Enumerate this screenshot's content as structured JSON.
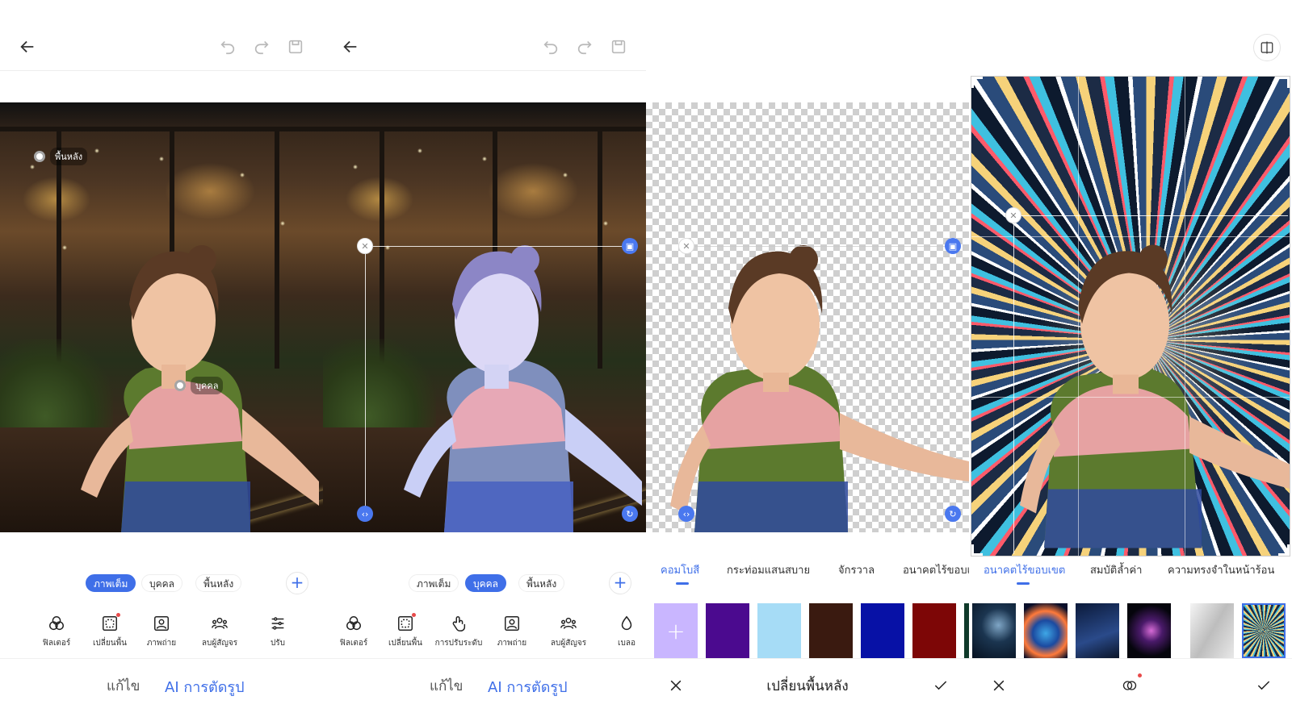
{
  "panels": [
    {
      "id": "panel-1",
      "toolbar": {
        "back": "arrow-left-icon",
        "undo": "undo-icon",
        "redo": "redo-icon",
        "save": "save-icon"
      },
      "photo_tags": {
        "background": "พื้นหลัง",
        "person": "บุคคล"
      },
      "modes": [
        "ภาพเต็ม",
        "บุคคล",
        "พื้นหลัง"
      ],
      "active_mode": "ภาพเต็ม",
      "tools": [
        {
          "label": "ฟิลเตอร์",
          "icon": "filter-icon"
        },
        {
          "label": "เปลี่ยนพื้น",
          "icon": "change-background-icon",
          "badge": true
        },
        {
          "label": "ภาพถ่าย",
          "icon": "portrait-icon"
        },
        {
          "label": "ลบผู้สัญจร",
          "icon": "remove-people-icon"
        },
        {
          "label": "ปรับ",
          "icon": "adjust-sliders-icon"
        }
      ],
      "bottom_tabs": {
        "edit": "แก้ไข",
        "ai": "AI การตัดรูป"
      }
    },
    {
      "id": "panel-2",
      "modes": [
        "ภาพเต็ม",
        "บุคคล",
        "พื้นหลัง"
      ],
      "active_mode": "บุคคล",
      "tools": [
        {
          "label": "ฟิลเตอร์",
          "icon": "filter-icon"
        },
        {
          "label": "เปลี่ยนพื้น",
          "icon": "change-background-icon",
          "badge": true
        },
        {
          "label": "การปรับระดับ",
          "icon": "tap-adjust-icon"
        },
        {
          "label": "ภาพถ่าย",
          "icon": "portrait-icon"
        },
        {
          "label": "ลบผู้สัญจร",
          "icon": "remove-people-icon"
        },
        {
          "label": "เบลอ",
          "icon": "blur-drop-icon"
        }
      ],
      "bottom_tabs": {
        "edit": "แก้ไข",
        "ai": "AI การตัดรูป"
      }
    },
    {
      "id": "panel-3",
      "categories": [
        "คอมโบสี",
        "กระท่อมแสนสบาย",
        "จักรวาล",
        "อนาคตไร้ขอบเ"
      ],
      "active_category": "คอมโบสี",
      "swatch_colors": [
        "#c9b6ff",
        "#4b0a8f",
        "#a6dcf6",
        "#3a1a10",
        "#0711a6",
        "#7d0606"
      ],
      "bottom": {
        "title": "เปลี่ยนพื้นหลัง",
        "cancel": "close-icon",
        "confirm": "check-icon"
      }
    },
    {
      "id": "panel-4",
      "categories": [
        "อนาคตไร้ขอบเขต",
        "สมบัติล้ำค่า",
        "ความทรงจำในหน้าร้อน"
      ],
      "active_category": "อนาคตไร้ขอบเขต",
      "bottom": {
        "cancel": "close-icon",
        "compare": "compare-icon",
        "confirm": "check-icon"
      }
    }
  ],
  "colors": {
    "accent": "#3f6fe8",
    "badge": "#e84a4a"
  }
}
